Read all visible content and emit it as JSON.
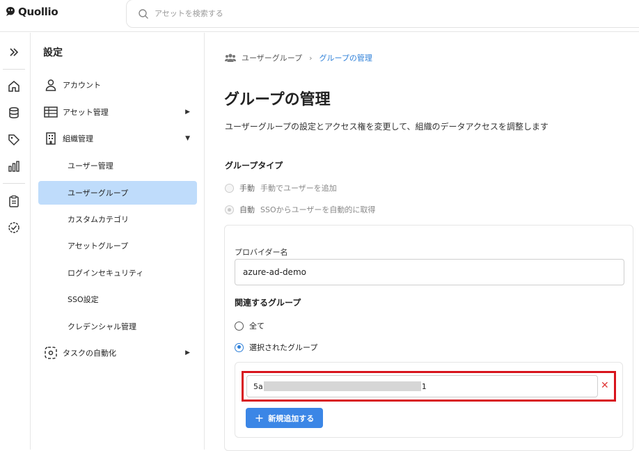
{
  "app": {
    "name": "Quollio"
  },
  "search": {
    "placeholder": "アセットを検索する"
  },
  "rail": {
    "icons": [
      "expand-icon",
      "home-icon",
      "database-icon",
      "tag-icon",
      "chart-icon",
      "clipboard-icon",
      "check-circle-icon"
    ]
  },
  "sidebar": {
    "title": "設定",
    "items": [
      {
        "label": "アカウント",
        "icon": "user-icon"
      },
      {
        "label": "アセット管理",
        "icon": "table-icon",
        "caret": "▶"
      },
      {
        "label": "組織管理",
        "icon": "building-icon",
        "caret": "▼"
      },
      {
        "label": "ユーザー管理"
      },
      {
        "label": "ユーザーグループ",
        "active": true
      },
      {
        "label": "カスタムカテゴリ"
      },
      {
        "label": "アセットグループ"
      },
      {
        "label": "ログインセキュリティ"
      },
      {
        "label": "SSO設定"
      },
      {
        "label": "クレデンシャル管理"
      },
      {
        "label": "タスクの自動化",
        "icon": "automation-icon",
        "caret": "▶"
      }
    ]
  },
  "breadcrumb": {
    "parent": "ユーザーグループ",
    "current": "グループの管理"
  },
  "page": {
    "title": "グループの管理",
    "description": "ユーザーグループの設定とアクセス権を変更して、組織のデータアクセスを調整します"
  },
  "group_type": {
    "label": "グループタイプ",
    "options": [
      {
        "label": "手動",
        "sub": "手動でユーザーを追加",
        "selected": false
      },
      {
        "label": "自動",
        "sub": "SSOからユーザーを自動的に取得",
        "selected": true
      }
    ]
  },
  "provider": {
    "label": "プロバイダー名",
    "value": "azure-ad-demo"
  },
  "related": {
    "label": "関連するグループ",
    "options": [
      {
        "label": "全て",
        "selected": false
      },
      {
        "label": "選択されたグループ",
        "selected": true
      }
    ],
    "group_value_prefix": "5a",
    "group_value_suffix": "1",
    "add_label": "新規追加する"
  },
  "colors": {
    "accent": "#3b86e6",
    "active_bg": "#bfdcfb",
    "highlight": "#d8141d"
  }
}
